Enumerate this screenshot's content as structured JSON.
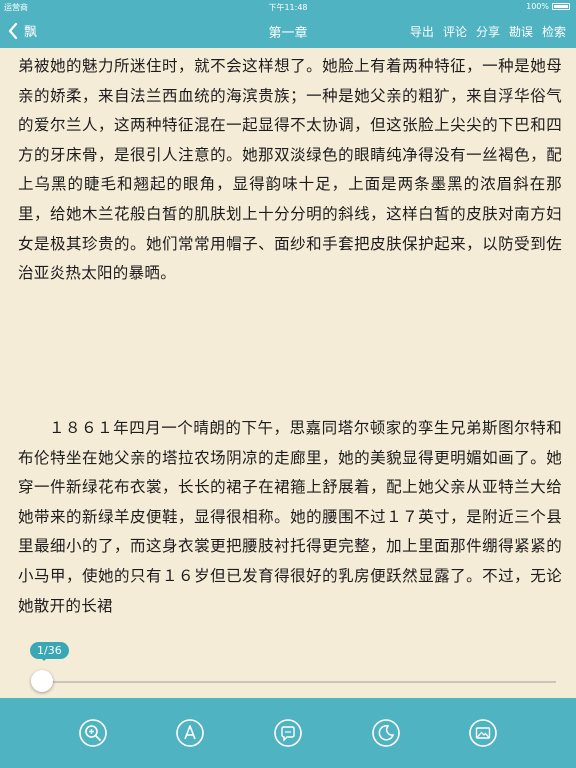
{
  "status_bar": {
    "carrier": "运营商",
    "time": "下午11:48",
    "battery": "100%"
  },
  "nav": {
    "back_label": "飘",
    "title": "第一章",
    "actions": [
      "导出",
      "评论",
      "分享",
      "勘误",
      "检索"
    ]
  },
  "content": {
    "paragraphs": [
      "弟被她的魅力所迷住时，就不会这样想了。她脸上有着两种特征，一种是她母亲的娇柔，来自法兰西血统的海滨贵族；一种是她父亲的粗犷，来自浮华俗气的爱尔兰人，这两种特征混在一起显得不太协调，但这张脸上尖尖的下巴和四方的牙床骨，是很引人注意的。她那双淡绿色的眼睛纯净得没有一丝褐色，配上乌黑的睫毛和翘起的眼角，显得韵味十足，上面是两条墨黑的浓眉斜在那里，给她木兰花般白皙的肌肤划上十分分明的斜线，这样白皙的皮肤对南方妇女是极其珍贵的。她们常常用帽子、面纱和手套把皮肤保护起来，以防受到佐治亚炎热太阳的暴晒。",
      "１８６１年四月一个晴朗的下午，思嘉同塔尔顿家的孪生兄弟斯图尔特和布伦特坐在她父亲的塔拉农场阴凉的走廊里，她的美貌显得更明媚如画了。她穿一件新绿花布衣裳，长长的裙子在裙箍上舒展着，配上她父亲从亚特兰大给她带来的新绿羊皮便鞋，显得很相称。她的腰围不过１７英寸，是附近三个县里最细小的了，而这身衣裳更把腰肢衬托得更完整，加上里面那件绷得紧紧的小马甲，使她的只有１６岁但已发育得很好的乳房便跃然显露了。不过，无论她散开的长裙"
    ]
  },
  "progress": {
    "label": "1/36",
    "current": 1,
    "total": 36
  },
  "toolbar": {
    "icons": [
      "zoom-icon",
      "font-icon",
      "comment-icon",
      "night-mode-icon",
      "image-icon"
    ]
  },
  "colors": {
    "accent": "#4fb3c2",
    "page_bg": "#f5ecd8",
    "text": "#1c1c1c"
  }
}
